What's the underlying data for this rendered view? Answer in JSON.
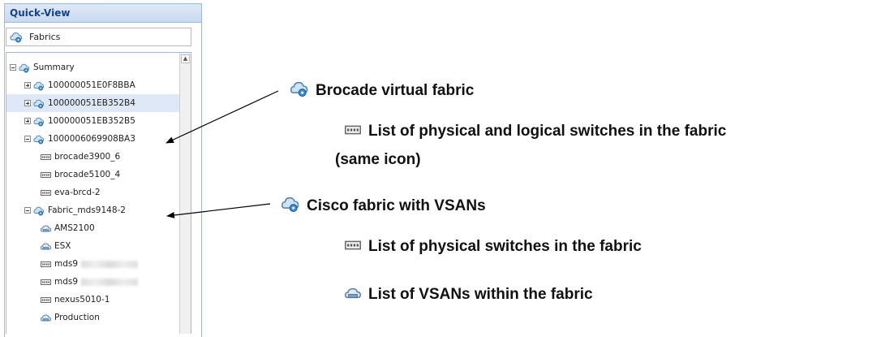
{
  "panel": {
    "title": "Quick-View",
    "selector_label": "Fabrics",
    "selector_icon": "fabric-icon"
  },
  "tree": {
    "root": {
      "label": "Summary",
      "expanded": true,
      "icon": "fabric-icon"
    },
    "fabrics": [
      {
        "label": "100000051E0F8BBA",
        "expanded": false,
        "icon": "fabric-icon"
      },
      {
        "label": "100000051EB352B4",
        "expanded": false,
        "icon": "fabric-icon",
        "selected": true
      },
      {
        "label": "100000051EB352B5",
        "expanded": false,
        "icon": "fabric-icon"
      },
      {
        "label": "1000006069908BA3",
        "expanded": true,
        "icon": "fabric-icon",
        "children": [
          {
            "label": "brocade3900_6",
            "icon": "switch-icon"
          },
          {
            "label": "brocade5100_4",
            "icon": "switch-icon"
          },
          {
            "label": "eva-brcd-2",
            "icon": "switch-icon"
          }
        ]
      },
      {
        "label": "Fabric_mds9148-2",
        "expanded": true,
        "icon": "fabric-icon",
        "children": [
          {
            "label": "AMS2100",
            "icon": "vsan-icon"
          },
          {
            "label": "ESX",
            "icon": "vsan-icon"
          },
          {
            "label": "mds9",
            "icon": "switch-icon",
            "redacted": true
          },
          {
            "label": "mds9",
            "icon": "switch-icon",
            "redacted": true
          },
          {
            "label": "nexus5010-1",
            "icon": "switch-icon"
          },
          {
            "label": "Production",
            "icon": "vsan-icon"
          }
        ]
      }
    ]
  },
  "annotations": {
    "brocade_fabric": "Brocade virtual fabric",
    "brocade_switches_line1": "List of physical and logical switches in the fabric",
    "brocade_switches_line2": "(same icon)",
    "cisco_fabric": "Cisco fabric with VSANs",
    "cisco_switches": "List of physical switches in the fabric",
    "cisco_vsans": "List of VSANs within the fabric"
  }
}
